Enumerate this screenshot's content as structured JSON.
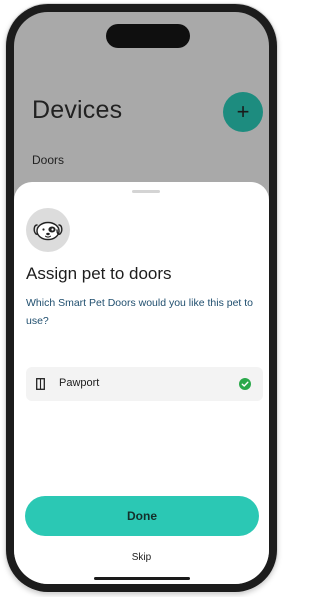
{
  "background": {
    "title": "Devices",
    "add_button_glyph": "+",
    "section_label": "Doors"
  },
  "sheet": {
    "title": "Assign pet to doors",
    "subtitle": "Which Smart Pet Doors would you like this pet to use?",
    "avatar_icon": "dog-face-icon",
    "doors": [
      {
        "name": "Pawport",
        "icon": "door-icon",
        "selected": true
      }
    ],
    "primary_button": "Done",
    "secondary_link": "Skip"
  },
  "colors": {
    "accent": "#2bc8b4",
    "accent_dark": "#1d8c7f",
    "check_green": "#2aa84a",
    "subtitle_text": "#1f4e6e"
  }
}
